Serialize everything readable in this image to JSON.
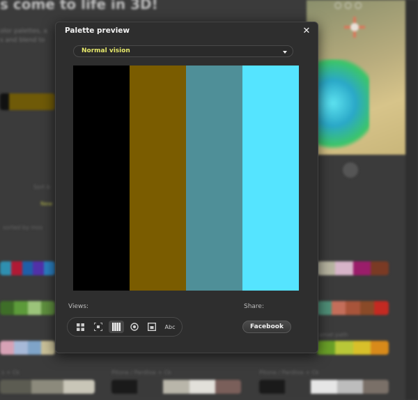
{
  "background": {
    "headline": "s come to life in 3D!",
    "text_line_1": "olor palettes, a",
    "text_line_2": "s and blend to",
    "sort_label": "Sort b",
    "filter_value": "New",
    "sorted_note": "sorted by mos",
    "path_label": "amet path",
    "row_label_1": "s + Ck",
    "row_label_2": "Pitone / Pardlise + Ck",
    "row_label_3": "Pitone / Pardlise + Ck"
  },
  "dialog": {
    "title": "Palette preview",
    "close_symbol": "✕",
    "vision_select": {
      "value": "Normal vision"
    },
    "palette": [
      "#000000",
      "#7a5c00",
      "#4f8f98",
      "#55e4ff"
    ],
    "views_label": "Views:",
    "share_label": "Share:",
    "views": [
      {
        "icon": "grid-icon",
        "active": false
      },
      {
        "icon": "focus-icon",
        "active": false
      },
      {
        "icon": "stripes-icon",
        "active": true
      },
      {
        "icon": "circle-icon",
        "active": false
      },
      {
        "icon": "square-icon",
        "active": false
      },
      {
        "icon": "text-icon",
        "label": "Abc",
        "active": false
      }
    ],
    "share_facebook": "Facebook"
  },
  "colors": {
    "accent_yellow": "#e6e86a",
    "dialog_bg": "#2e2e2e"
  }
}
